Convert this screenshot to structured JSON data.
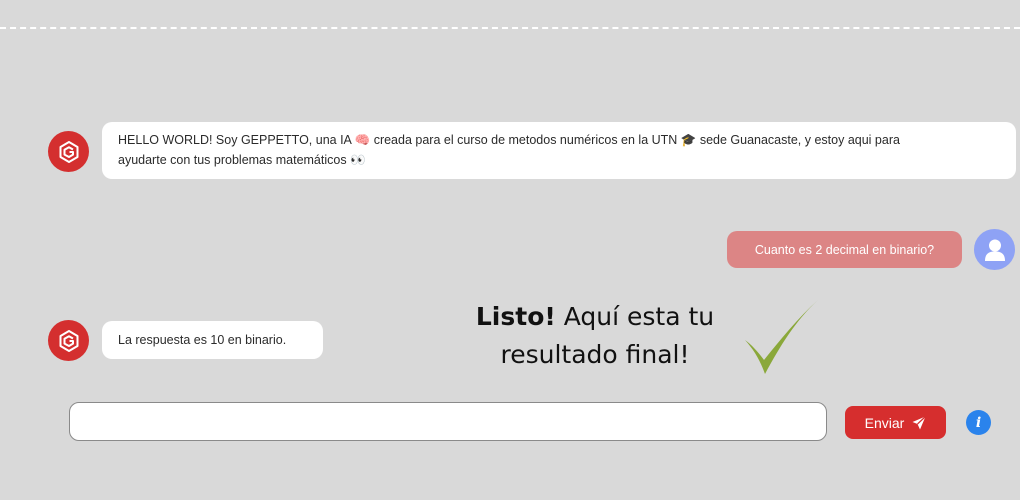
{
  "messages": [
    {
      "sender": "bot",
      "line1": "HELLO WORLD! Soy GEPPETTO, una IA 🧠 creada para el curso de metodos numéricos en la UTN 🎓 sede Guanacaste, y estoy aqui para",
      "line2": "ayudarte con tus problemas matemáticos 👀"
    },
    {
      "sender": "user",
      "text": "Cuanto es 2 decimal en binario?"
    },
    {
      "sender": "bot",
      "text": "La respuesta es 10 en binario."
    }
  ],
  "overlay": {
    "bold": "Listo!",
    "line1_rest": " Aquí esta tu",
    "line2": "resultado final!"
  },
  "input": {
    "value": "",
    "placeholder": ""
  },
  "send_button": {
    "label": "Enviar",
    "icon": "paper-plane-icon"
  },
  "info_button": {
    "label": "i",
    "icon": "info-icon"
  },
  "colors": {
    "background": "#d9d9d9",
    "bot_avatar": "#d42f2f",
    "user_bubble": "#dc8585",
    "user_avatar": "#8ea2f5",
    "send_button": "#d62e2e",
    "info_button": "#2a83ec",
    "checkmark": "#8aa83a"
  }
}
